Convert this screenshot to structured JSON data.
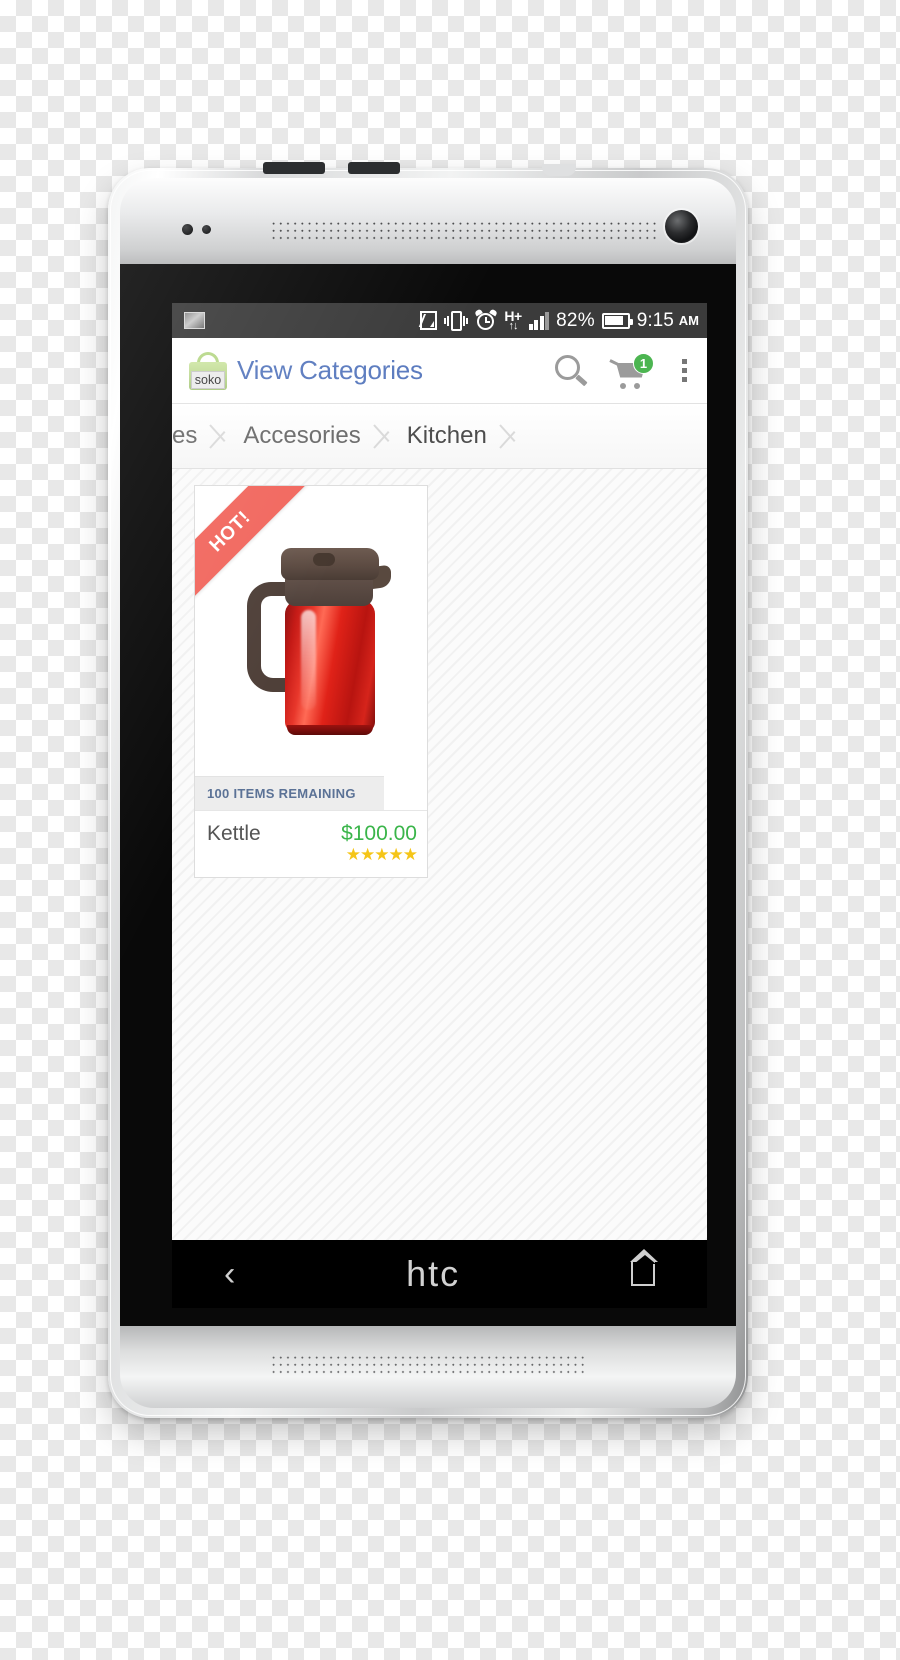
{
  "device": {
    "brand_logo": "htc",
    "nav": {
      "back_icon": "back-chevron-icon",
      "home_icon": "home-icon"
    }
  },
  "statusbar": {
    "left_icons": [
      "screenshot-icon"
    ],
    "right_icons": [
      "nfc-icon",
      "vibrate-icon",
      "alarm-icon",
      "hsdpa-plus-icon",
      "signal-bars-icon",
      "battery-icon"
    ],
    "hsdpa_label": "H+",
    "hsdpa_arrows": "↑↓",
    "battery_percent": "82%",
    "time": "9:15",
    "ampm": "AM"
  },
  "header": {
    "logo_text": "soko",
    "title": "View Categories",
    "search_icon": "search-icon",
    "cart_icon": "shopping-cart-icon",
    "cart_badge": "1",
    "overflow_icon": "overflow-menu-icon"
  },
  "breadcrumb": {
    "items": [
      {
        "label": "es",
        "truncated": true
      },
      {
        "label": "Accesories",
        "truncated": false
      },
      {
        "label": "Kitchen",
        "truncated": false
      }
    ]
  },
  "product": {
    "ribbon_label": "HOT!",
    "stock_label": "100 ITEMS REMAINING",
    "name": "Kettle",
    "price": "$100.00",
    "stars": "★★★★★",
    "image_alt": "red-thermos-kettle"
  },
  "colors": {
    "accent_blue": "#5b7bbf",
    "price_green": "#3ab54a",
    "badge_green": "#4cb551",
    "ribbon_red": "#f2685f",
    "star_yellow": "#f5c518",
    "stock_text": "#5b7296"
  }
}
